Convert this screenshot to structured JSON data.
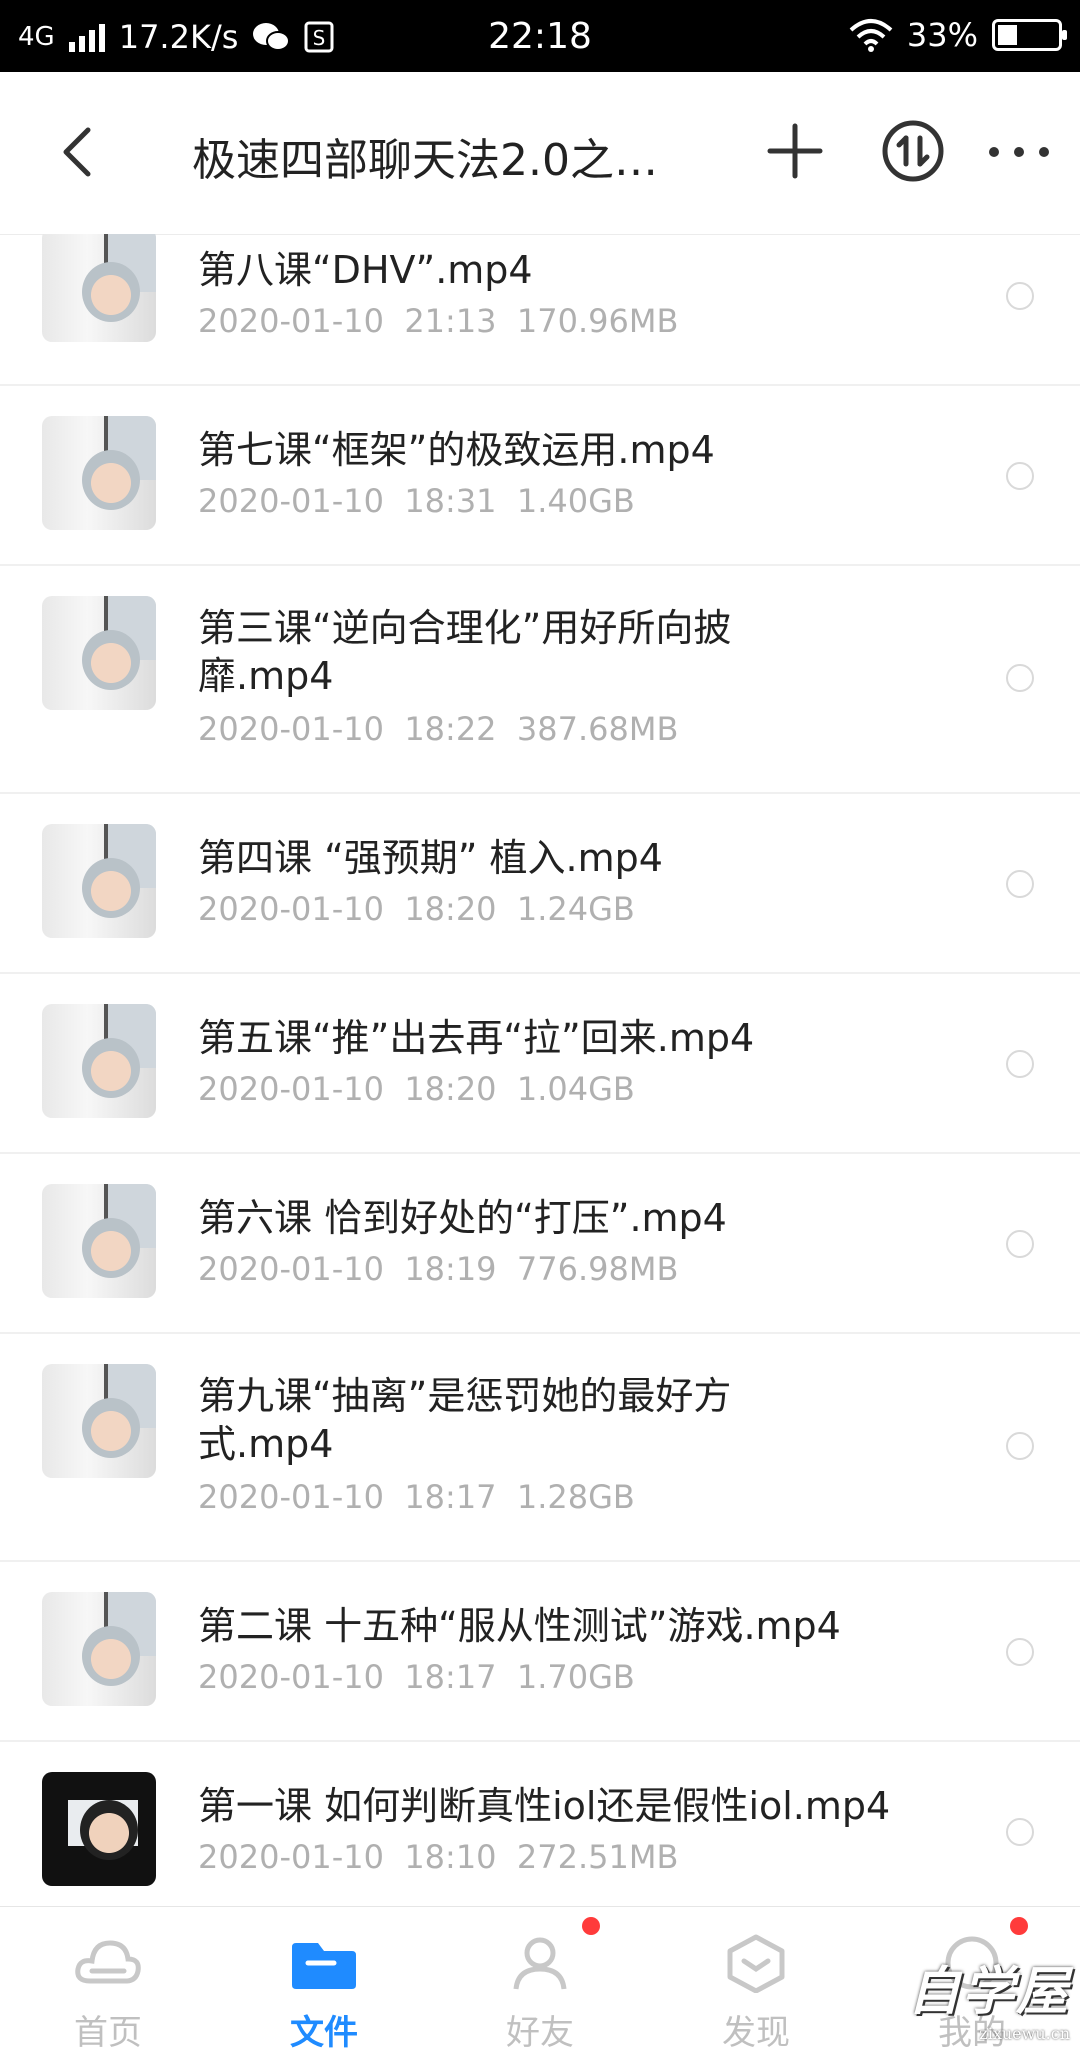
{
  "status_bar": {
    "network": "4G",
    "speed": "17.2K/s",
    "time": "22:18",
    "battery": "33%",
    "battery_level": 0.33
  },
  "header": {
    "title": "极速四部聊天法2.0之…",
    "back_icon": "back-arrow-icon",
    "add_icon": "plus-icon",
    "sort_icon": "transfer-icon",
    "more_icon": "more-icon"
  },
  "files": [
    {
      "name": "第八课“DHV”.mp4",
      "meta": "2020-01-10  21:13  170.96MB"
    },
    {
      "name": "第七课“框架”的极致运用.mp4",
      "meta": "2020-01-10  18:31  1.40GB"
    },
    {
      "name": "第三课“逆向合理化”用好所向披靡.mp4",
      "meta": "2020-01-10  18:22  387.68MB"
    },
    {
      "name": "第四课 “强预期” 植入.mp4",
      "meta": "2020-01-10  18:20  1.24GB"
    },
    {
      "name": "第五课“推”出去再“拉”回来.mp4",
      "meta": "2020-01-10  18:20  1.04GB"
    },
    {
      "name": "第六课 恰到好处的“打压”.mp4",
      "meta": "2020-01-10  18:19  776.98MB"
    },
    {
      "name": "第九课“抽离”是惩罚她的最好方式.mp4",
      "meta": "2020-01-10  18:17  1.28GB"
    },
    {
      "name": "第二课 十五种“服从性测试”游戏.mp4",
      "meta": "2020-01-10  18:17  1.70GB"
    },
    {
      "name": "第一课 如何判断真性iol还是假性iol.mp4",
      "meta": "2020-01-10  18:10  272.51MB"
    }
  ],
  "bottom_nav": [
    {
      "label": "首页",
      "icon": "cloud-icon",
      "active": false
    },
    {
      "label": "文件",
      "icon": "folder-icon",
      "active": true
    },
    {
      "label": "好友",
      "icon": "friends-icon",
      "active": false
    },
    {
      "label": "发现",
      "icon": "discover-icon",
      "active": false
    },
    {
      "label": "我的",
      "icon": "profile-icon",
      "active": false
    }
  ],
  "watermark": {
    "big": "自学屋",
    "small": "zixuewu.cn"
  },
  "colors": {
    "accent": "#1f8bff",
    "badge": "#ff3b3b",
    "meta_text": "#b0b0b0"
  }
}
